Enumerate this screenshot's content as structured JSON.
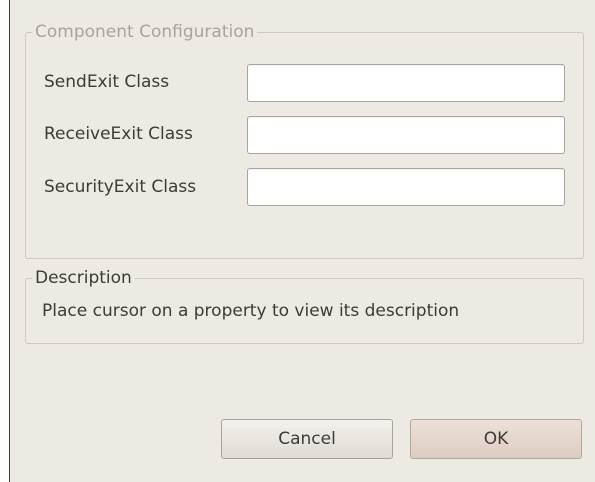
{
  "config_group": {
    "legend": "Component Configuration",
    "fields": [
      {
        "label": "SendExit Class",
        "value": ""
      },
      {
        "label": "ReceiveExit Class",
        "value": ""
      },
      {
        "label": "SecurityExit Class",
        "value": ""
      }
    ]
  },
  "description_group": {
    "legend": "Description",
    "text": "Place cursor on a property to view its description"
  },
  "buttons": {
    "cancel_label": "Cancel",
    "ok_label": "OK"
  },
  "colors": {
    "dialog_background": "#ede9e3",
    "text": "#3c3b37",
    "disabled_text": "#a9a49b",
    "input_background": "#ffffff"
  }
}
